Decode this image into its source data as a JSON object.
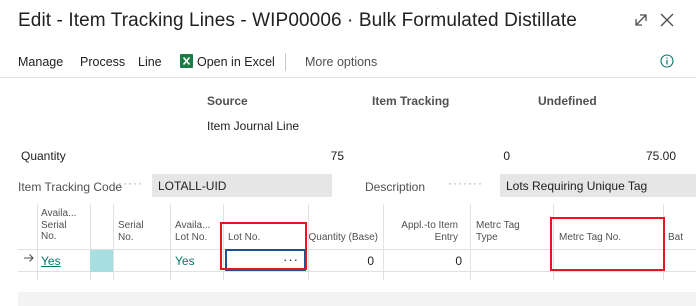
{
  "window": {
    "title": "Edit - Item Tracking Lines - WIP00006 · Bulk Formulated Distillate",
    "icons": {
      "expand": "expand-icon",
      "close": "close-icon"
    }
  },
  "actions": {
    "manage": "Manage",
    "process": "Process",
    "line": "Line",
    "open_in_excel": "Open in Excel",
    "more_options": "More options",
    "icons": {
      "excel": "excel-icon",
      "info": "info-icon"
    }
  },
  "summary": {
    "source_header": "Source",
    "item_tracking_header": "Item Tracking",
    "undefined_header": "Undefined",
    "source_value": "Item Journal Line",
    "quantity_label": "Quantity",
    "quantity_source": "75",
    "quantity_item_tracking": "0",
    "quantity_undefined": "75.00"
  },
  "fields": {
    "item_tracking_code_label": "Item Tracking Code",
    "item_tracking_code_value": "LOTALL-UID",
    "description_label": "Description",
    "description_value": "Lots Requiring Unique Tag"
  },
  "grid": {
    "headers": {
      "avail_serial": [
        "Availa...",
        "Serial",
        "No."
      ],
      "serial_no": [
        "Serial",
        "No."
      ],
      "avail_lot": [
        "Availa...",
        "Lot No."
      ],
      "lot_no": [
        "Lot No."
      ],
      "quantity_base": [
        "Quantity (Base)"
      ],
      "appl_to_item_entry": [
        "Appl.-to Item",
        "Entry"
      ],
      "metrc_tag_type": [
        "Metrc Tag",
        "Type"
      ],
      "metrc_tag_no": [
        "Metrc Tag No."
      ],
      "batch": [
        "Bat"
      ]
    },
    "rows": [
      {
        "avail_serial": "Yes",
        "serial_no": "",
        "avail_lot": "Yes",
        "lot_no": "",
        "lot_no_assist": "···",
        "quantity_base": "0",
        "appl_to_item_entry": "0",
        "metrc_tag_type": "",
        "metrc_tag_no": ""
      }
    ],
    "icons": {
      "current_row": "arrow-right-icon"
    }
  },
  "colors": {
    "accent_link": "#00786b",
    "highlight_cell": "#a7dfe0",
    "focus_border": "#1d4f91",
    "annotation_red": "#e8151e",
    "field_background": "#e6e6e6"
  }
}
